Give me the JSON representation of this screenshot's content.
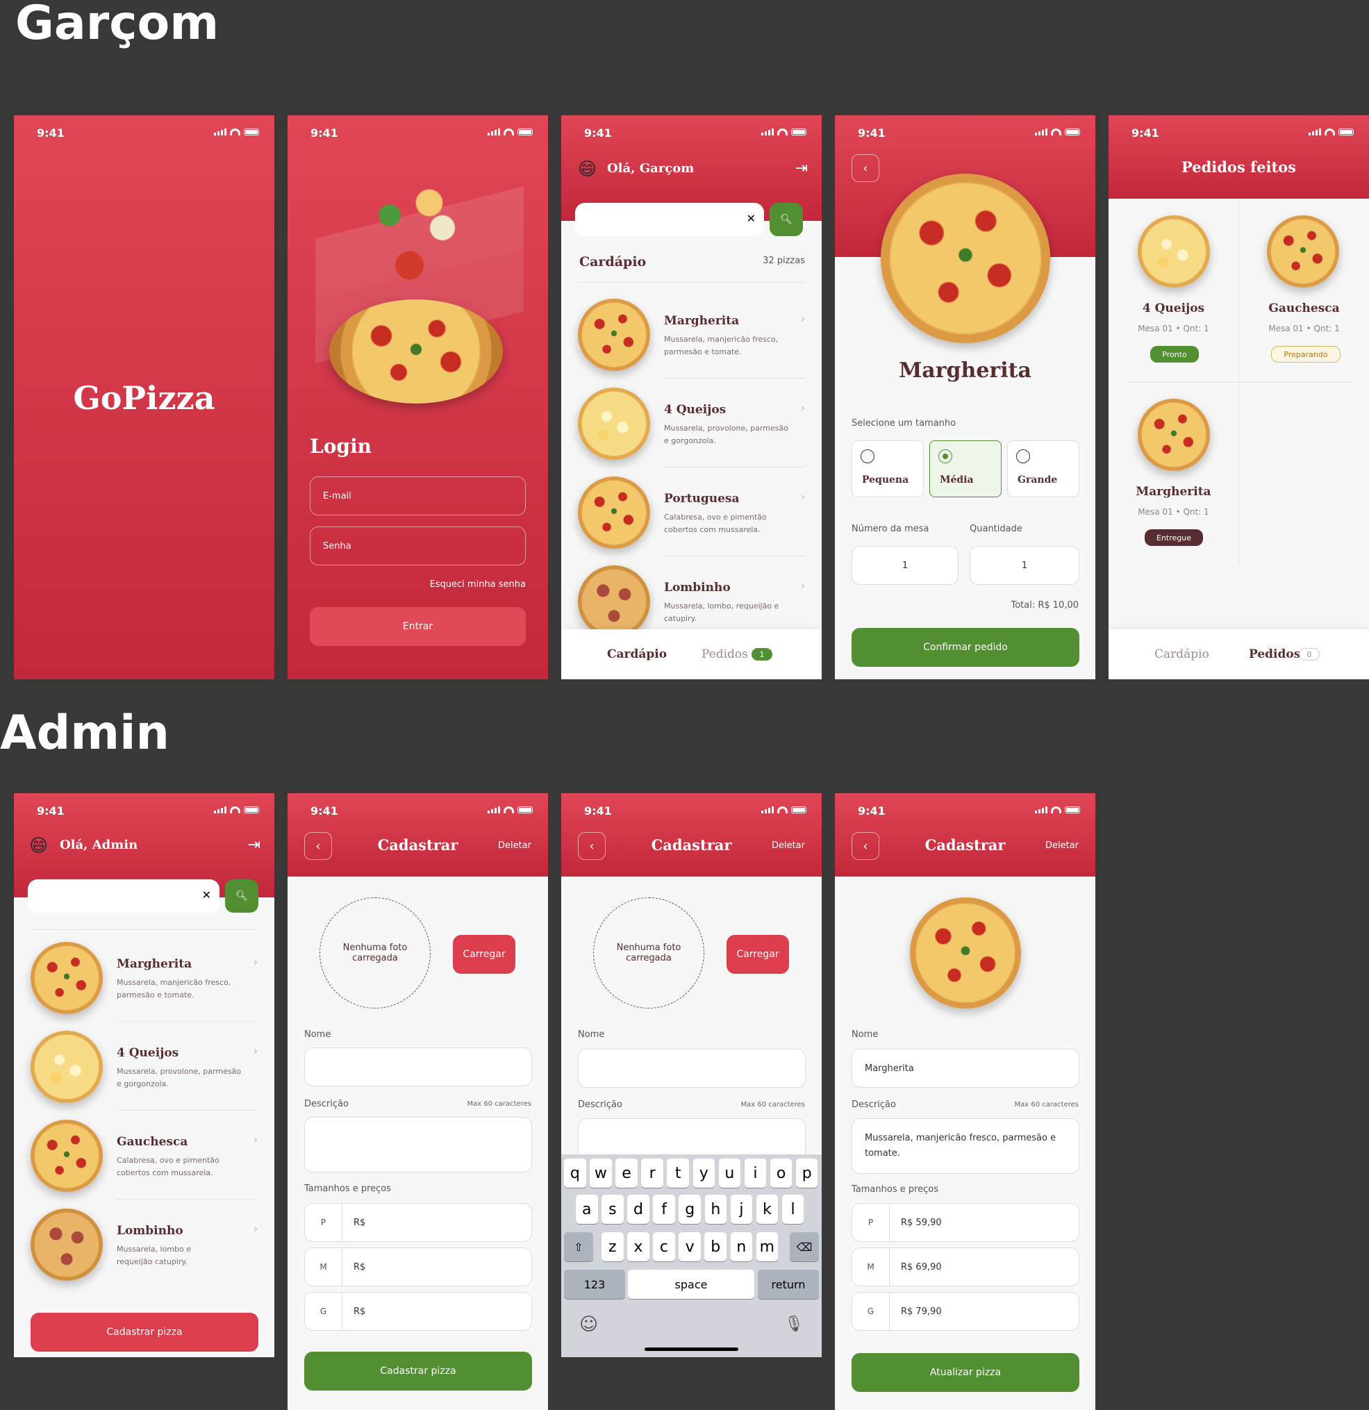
{
  "sections": {
    "garcom": "Garçom",
    "admin": "Admin"
  },
  "status": {
    "time": "9:41"
  },
  "splash": {
    "logo": "GoPizza"
  },
  "login": {
    "title": "Login",
    "email_placeholder": "E-mail",
    "password_placeholder": "Senha",
    "forgot": "Esqueci minha senha",
    "submit": "Entrar"
  },
  "home": {
    "greeting": "Olá, Garçom",
    "emoji": "😄",
    "menu_title": "Cardápio",
    "count": "32 pizzas",
    "items": [
      {
        "name": "Margherita",
        "desc": "Mussarela, manjericão fresco, parmesão e tomate."
      },
      {
        "name": "4 Queijos",
        "desc": "Mussarela, provolone, parmesão e gorgonzola."
      },
      {
        "name": "Portuguesa",
        "desc": "Calabresa, ovo e pimentão cobertos com mussarela."
      },
      {
        "name": "Lombinho",
        "desc": "Mussarela, lombo, requeijão e catupiry."
      }
    ],
    "tab_menu": "Cardápio",
    "tab_orders": "Pedidos",
    "orders_badge": "1"
  },
  "product": {
    "name": "Margherita",
    "size_label": "Selecione um tamanho",
    "sizes": [
      "Pequena",
      "Média",
      "Grande"
    ],
    "table_label": "Número da mesa",
    "qty_label": "Quantidade",
    "table_value": "1",
    "qty_value": "1",
    "total": "Total: R$ 10,00",
    "confirm": "Confirmar pedido"
  },
  "orders": {
    "title": "Pedidos feitos",
    "items": [
      {
        "name": "4 Queijos",
        "table": "Mesa 01",
        "qty": "• Qnt: 1",
        "status": "Pronto"
      },
      {
        "name": "Gauchesca",
        "table": "Mesa 01",
        "qty": "• Qnt: 1",
        "status": "Preparando"
      },
      {
        "name": "Margherita",
        "table": "Mesa 01",
        "qty": "• Qnt: 1",
        "status": "Entregue"
      }
    ],
    "tab_menu": "Cardápio",
    "tab_orders": "Pedidos",
    "orders_badge": "0"
  },
  "admin_home": {
    "greeting": "Olá, Admin",
    "items": [
      {
        "name": "Margherita",
        "desc": "Mussarela, manjericão fresco, parmesão e tomate."
      },
      {
        "name": "4 Queijos",
        "desc": "Mussarela, provolone, parmesão e gorgonzola."
      },
      {
        "name": "Gauchesca",
        "desc": "Calabresa, ovo e pimentão cobertos com mussarela."
      },
      {
        "name": "Lombinho",
        "desc": "Mussarela, lombo e requeijão catupiry."
      }
    ],
    "register_btn": "Cadastrar pizza"
  },
  "register": {
    "title": "Cadastrar",
    "delete": "Deletar",
    "no_photo": "Nenhuma foto carregada",
    "upload": "Carregar",
    "name_label": "Nome",
    "desc_label": "Descrição",
    "max": "Max 60 caracteres",
    "sizes_label": "Tamanhos e preços",
    "sizes": [
      "P",
      "M",
      "G"
    ],
    "currency": "R$",
    "submit": "Cadastrar pizza"
  },
  "keyboard": {
    "row1": [
      "q",
      "w",
      "e",
      "r",
      "t",
      "y",
      "u",
      "i",
      "o",
      "p"
    ],
    "row2": [
      "a",
      "s",
      "d",
      "f",
      "g",
      "h",
      "j",
      "k",
      "l"
    ],
    "row3": [
      "z",
      "x",
      "c",
      "v",
      "b",
      "n",
      "m"
    ],
    "num": "123",
    "space": "space",
    "return": "return"
  },
  "edit": {
    "title": "Cadastrar",
    "delete": "Deletar",
    "name_label": "Nome",
    "name_value": "Margherita",
    "desc_label": "Descrição",
    "max": "Max 60 caracteres",
    "desc_value": "Mussarela, manjericão fresco, parmesão e tomate.",
    "sizes_label": "Tamanhos e preços",
    "prices": [
      {
        "size": "P",
        "price": "R$ 59,90"
      },
      {
        "size": "M",
        "price": "R$ 69,90"
      },
      {
        "size": "G",
        "price": "R$ 79,90"
      }
    ],
    "submit": "Atualizar pizza"
  },
  "colors": {
    "primary": "#dc3e4d",
    "green": "#528f33",
    "brown": "#572d31"
  }
}
